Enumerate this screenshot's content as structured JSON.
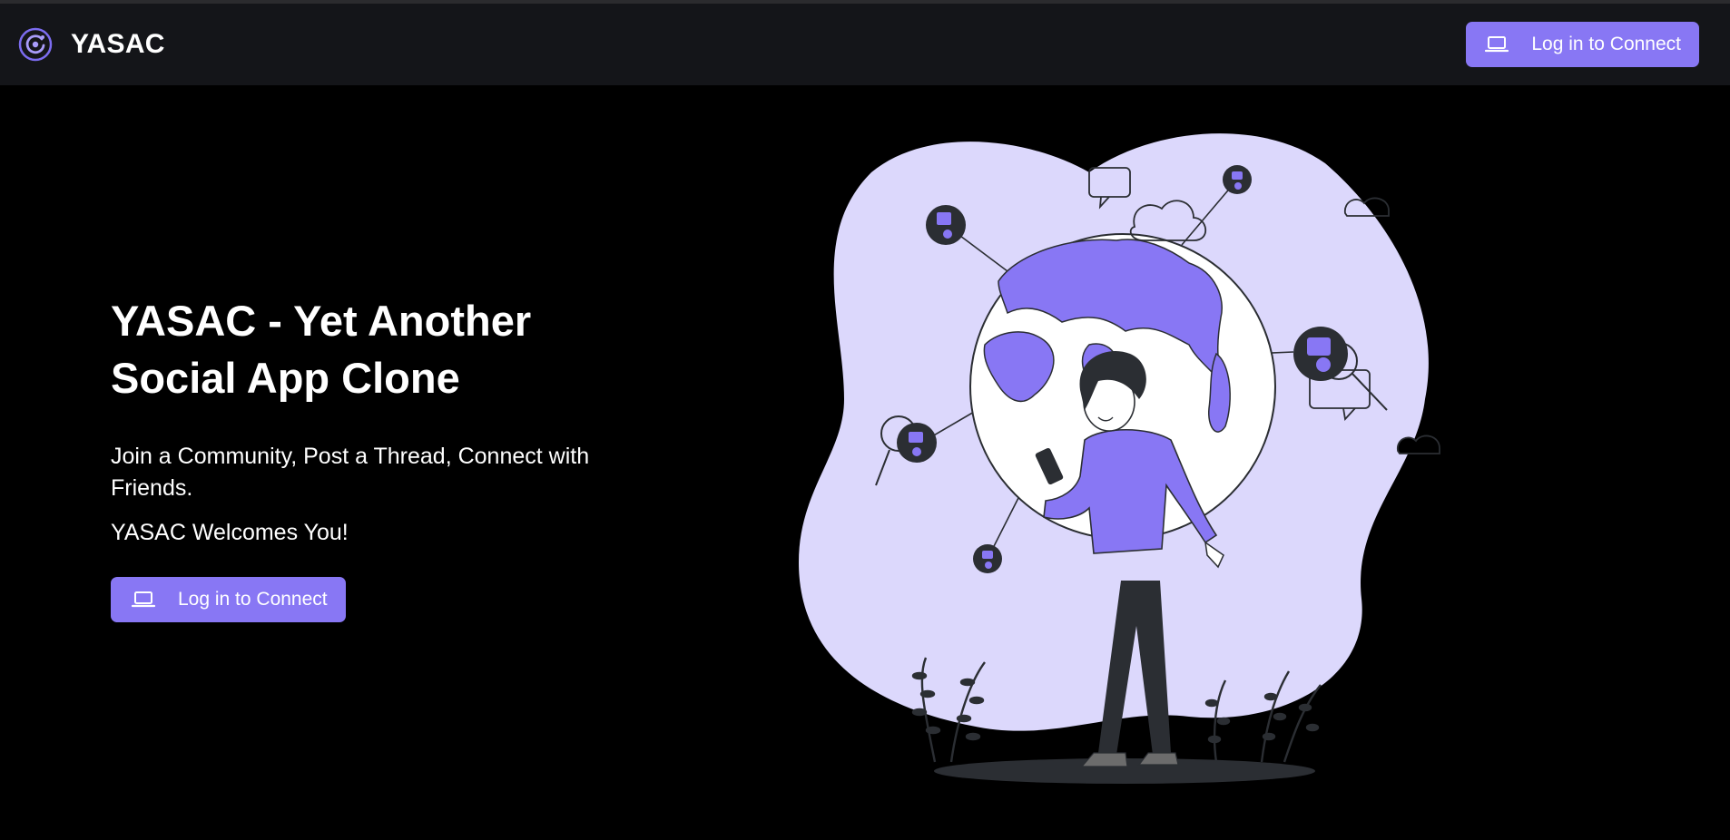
{
  "navbar": {
    "brand_name": "YASAC",
    "login_button_label": "Log in to Connect",
    "logo_icon": "orbit-icon",
    "login_icon": "laptop-icon"
  },
  "hero": {
    "title": "YASAC - Yet Another Social App Clone",
    "subtitle": "Join a Community, Post a Thread, Connect with Friends.",
    "welcome": "YASAC Welcomes You!",
    "cta_label": "Log in to Connect",
    "cta_icon": "laptop-icon"
  },
  "colors": {
    "accent": "#8877f4",
    "background": "#000000",
    "navbar": "#141519",
    "illustration_blob": "#dcd8fc",
    "illustration_dark": "#2b2e33"
  }
}
